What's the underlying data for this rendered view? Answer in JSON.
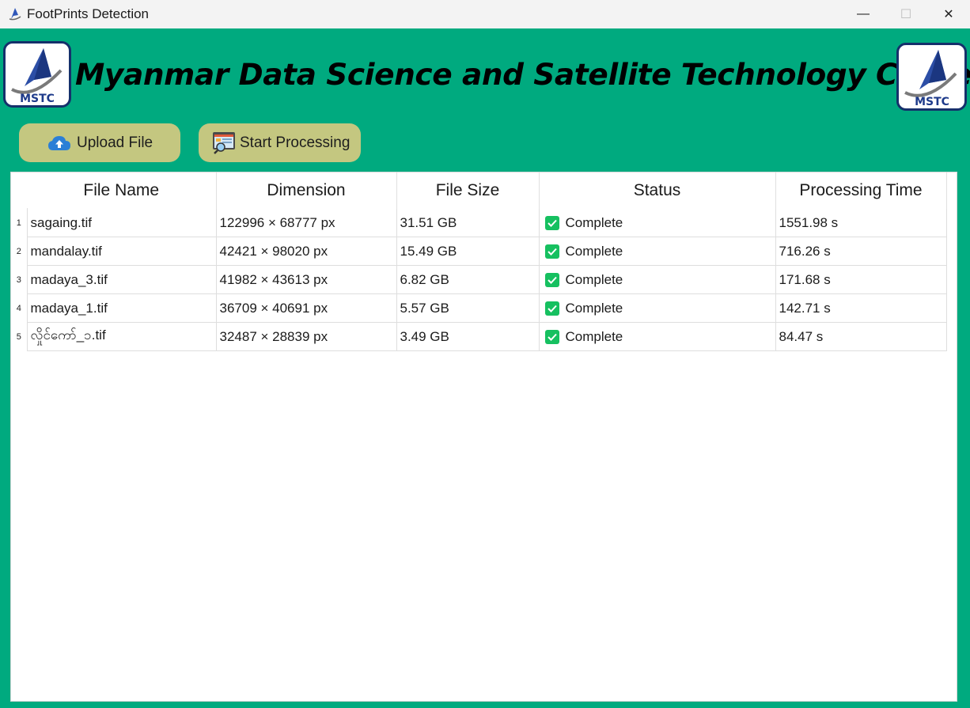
{
  "window": {
    "title": "FootPrints Detection",
    "controls": {
      "minimize": "—",
      "maximize": "☐",
      "close": "✕"
    }
  },
  "header": {
    "banner_title": "Myanmar Data Science and Satellite Technology Center",
    "logo_text": "MSTC"
  },
  "toolbar": {
    "upload_label": "Upload File",
    "start_label": "Start Processing"
  },
  "table": {
    "columns": [
      "File Name",
      "Dimension",
      "File Size",
      "Status",
      "Processing Time"
    ],
    "rows": [
      {
        "num": "1",
        "name": "sagaing.tif",
        "dimension": "122996 × 68777 px",
        "size": "31.51 GB",
        "status": "Complete",
        "time": "1551.98 s"
      },
      {
        "num": "2",
        "name": "mandalay.tif",
        "dimension": "42421 × 98020 px",
        "size": "15.49 GB",
        "status": "Complete",
        "time": "716.26 s"
      },
      {
        "num": "3",
        "name": "madaya_3.tif",
        "dimension": "41982 × 43613 px",
        "size": "6.82 GB",
        "status": "Complete",
        "time": "171.68 s"
      },
      {
        "num": "4",
        "name": "madaya_1.tif",
        "dimension": "36709 × 40691 px",
        "size": "5.57 GB",
        "status": "Complete",
        "time": "142.71 s"
      },
      {
        "num": "5",
        "name": "လှိုင်ကော်_၁.tif",
        "dimension": "32487 × 28839 px",
        "size": "3.49 GB",
        "status": "Complete",
        "time": "84.47 s"
      }
    ]
  },
  "colors": {
    "app_background": "#00aa7f",
    "button_background": "#c4c780",
    "logo_border": "#15306b",
    "status_check": "#16c060"
  },
  "icons": {
    "app": "satellite-logo-icon",
    "upload": "cloud-upload-icon",
    "start": "image-search-icon",
    "status": "check-icon"
  }
}
